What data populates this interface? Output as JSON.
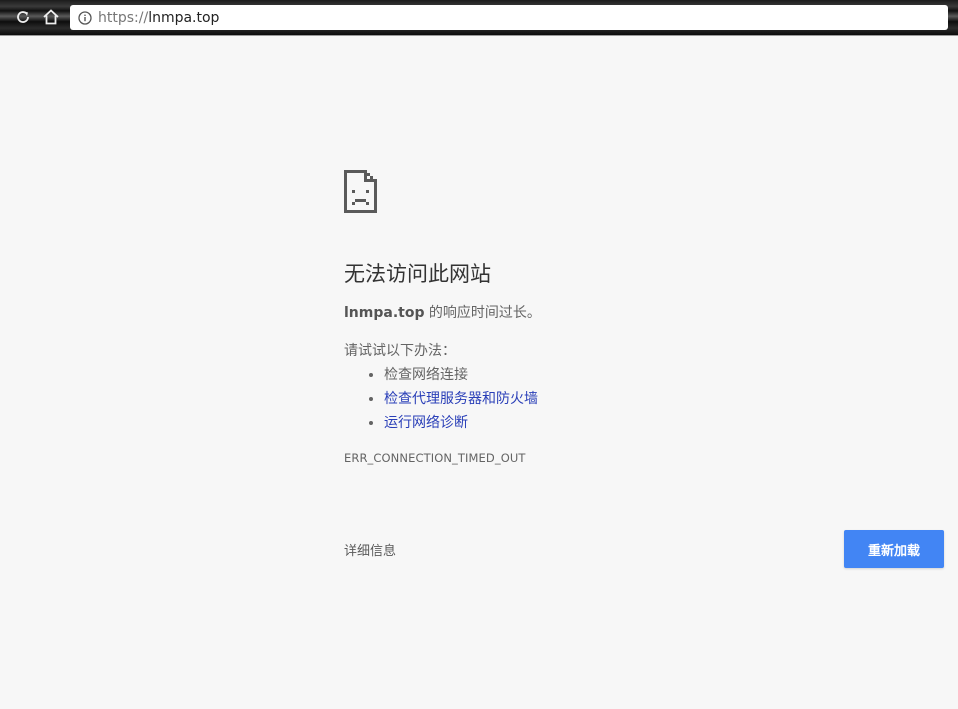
{
  "browser": {
    "url_scheme": "https://",
    "url_host": "lnmpa.top",
    "reload_icon": "reload-icon",
    "home_icon": "home-icon",
    "info_icon": "info-icon"
  },
  "error_page": {
    "icon": "sad-document-icon",
    "title": "无法访问此网站",
    "host": "lnmpa.top",
    "summary_suffix": " 的响应时间过长。",
    "suggestions_heading": "请试试以下办法：",
    "suggestions": [
      {
        "label": "检查网络连接",
        "is_link": false
      },
      {
        "label": "检查代理服务器和防火墙",
        "is_link": true
      },
      {
        "label": "运行网络诊断",
        "is_link": true
      }
    ],
    "error_code": "ERR_CONNECTION_TIMED_OUT",
    "details_label": "详细信息",
    "reload_label": "重新加载"
  },
  "colors": {
    "link": "#2a3fb8",
    "button": "#4285f4",
    "background": "#f7f7f7"
  }
}
